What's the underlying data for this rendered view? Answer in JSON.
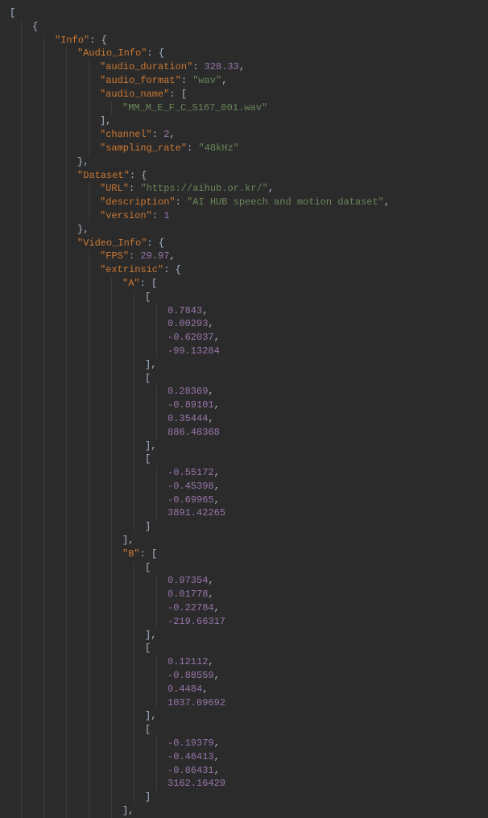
{
  "code": {
    "info_key": "\"Info\"",
    "audio_info_key": "\"Audio_Info\"",
    "audio_duration_key": "\"audio_duration\"",
    "audio_duration_val": "328.33",
    "audio_format_key": "\"audio_format\"",
    "audio_format_val": "\"wav\"",
    "audio_name_key": "\"audio_name\"",
    "audio_name_val": "\"MM_M_E_F_C_S167_001.wav\"",
    "channel_key": "\"channel\"",
    "channel_val": "2",
    "sampling_rate_key": "\"sampling_rate\"",
    "sampling_rate_val": "\"48kHz\"",
    "dataset_key": "\"Dataset\"",
    "url_key": "\"URL\"",
    "url_val": "\"https://aihub.or.kr/\"",
    "description_key": "\"description\"",
    "description_val": "\"AI HUB speech and motion dataset\"",
    "version_key": "\"version\"",
    "version_val": "1",
    "video_info_key": "\"Video_Info\"",
    "fps_key": "\"FPS\"",
    "fps_val": "29.97",
    "extrinsic_key": "\"extrinsic\"",
    "a_key": "\"A\"",
    "b_key": "\"B\"",
    "a1_1": "0.7843",
    "a1_2": "0.00293",
    "a1_3": "-0.62037",
    "a1_4": "-99.13284",
    "a2_1": "0.28369",
    "a2_2": "-0.89101",
    "a2_3": "0.35444",
    "a2_4": "886.48368",
    "a3_1": "-0.55172",
    "a3_2": "-0.45398",
    "a3_3": "-0.69965",
    "a3_4": "3891.42265",
    "b1_1": "0.97354",
    "b1_2": "0.01778",
    "b1_3": "-0.22784",
    "b1_4": "-219.66317",
    "b2_1": "0.12112",
    "b2_2": "-0.88559",
    "b2_3": "0.4484",
    "b2_4": "1037.09692",
    "b3_1": "-0.19379",
    "b3_2": "-0.46413",
    "b3_3": "-0.86431",
    "b3_4": "3162.16429"
  }
}
